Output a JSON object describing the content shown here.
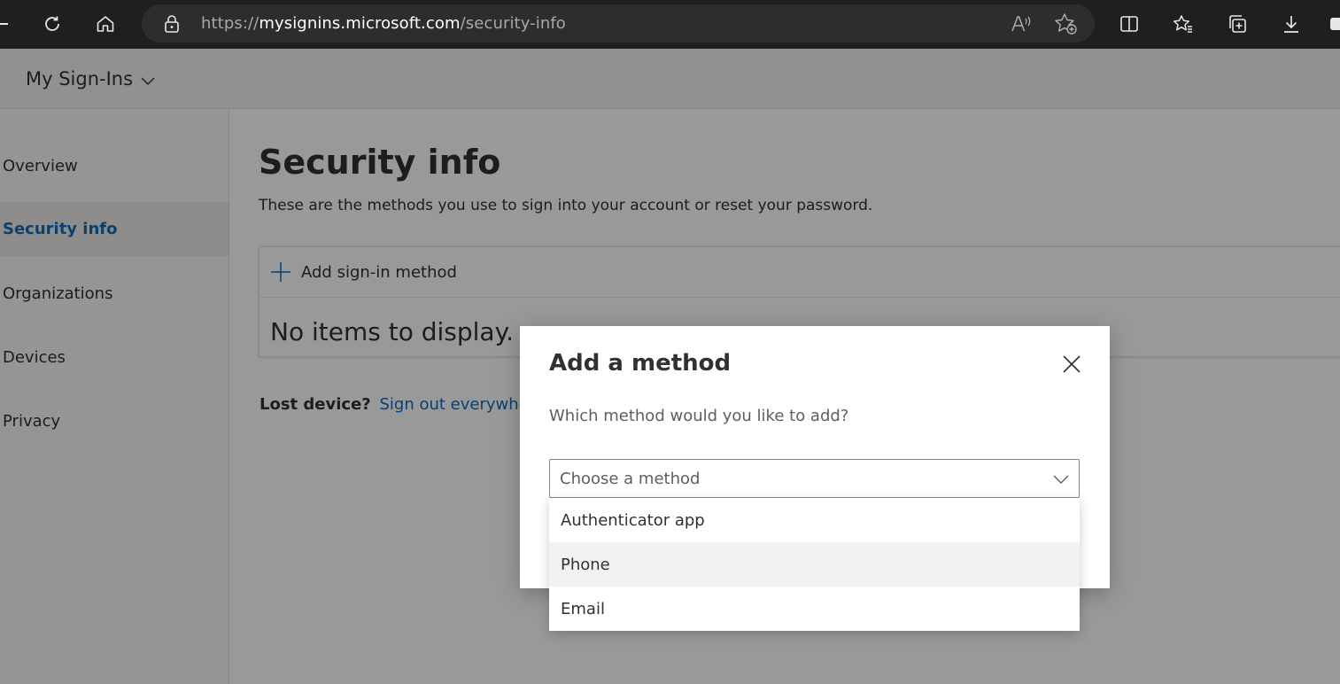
{
  "browser": {
    "url_prefix": "https://",
    "url_host": "mysignins.microsoft.com",
    "url_path": "/security-info"
  },
  "header": {
    "app_title": "My Sign-Ins"
  },
  "nav": {
    "items": [
      {
        "label": "Overview"
      },
      {
        "label": "Security info",
        "active": true
      },
      {
        "label": "Organizations"
      },
      {
        "label": "Devices"
      },
      {
        "label": "Privacy"
      }
    ]
  },
  "main": {
    "title": "Security info",
    "subtitle": "These are the methods you use to sign into your account or reset your password.",
    "add_method_label": "Add sign-in method",
    "empty_text": "No items to display.",
    "lost_device_label": "Lost device?",
    "sign_out_link": "Sign out everywhere"
  },
  "dialog": {
    "title": "Add a method",
    "question": "Which method would you like to add?",
    "select_placeholder": "Choose a method",
    "options": [
      {
        "label": "Authenticator app"
      },
      {
        "label": "Phone",
        "hovered": true
      },
      {
        "label": "Email"
      }
    ]
  },
  "colors": {
    "accent": "#0f6cbd",
    "chrome": "#1f1f1f",
    "overlay": "rgba(0,0,0,0.4)"
  }
}
